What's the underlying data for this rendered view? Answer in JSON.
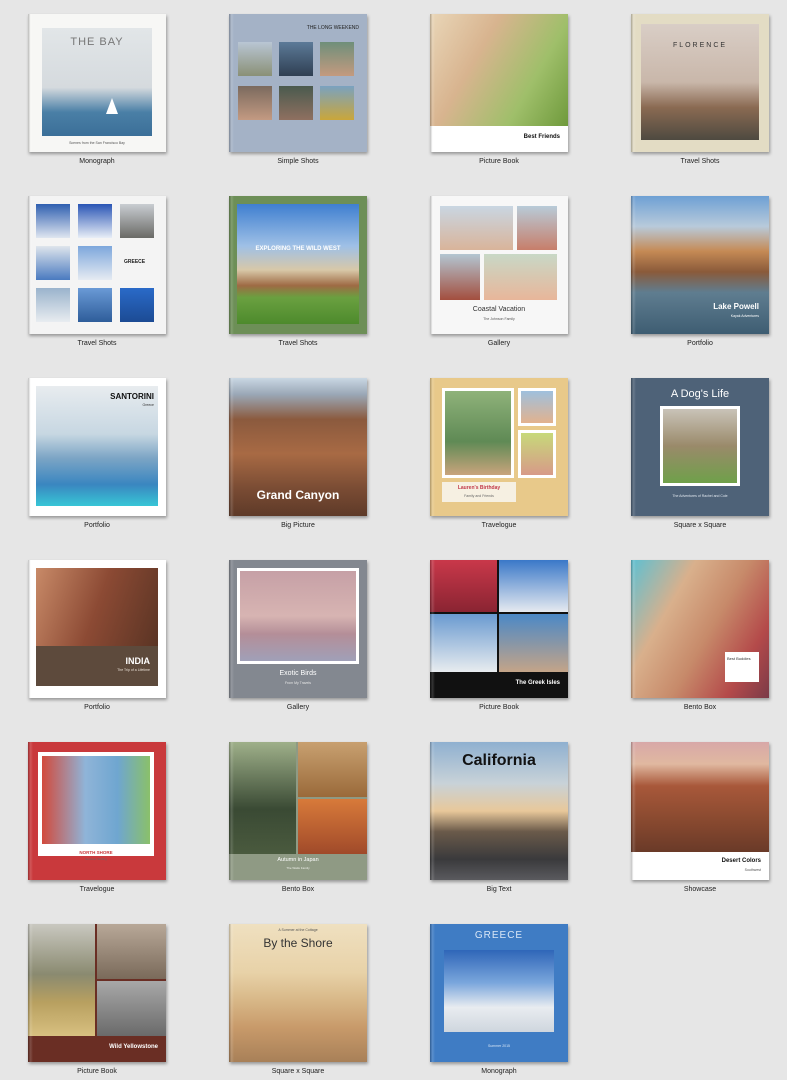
{
  "books": [
    {
      "title": "THE BAY",
      "subtitle": "Scenes from the San Francisco Bay",
      "style": "Monograph"
    },
    {
      "title": "THE LONG WEEKEND",
      "style": "Simple Shots"
    },
    {
      "title": "Best Friends",
      "style": "Picture Book"
    },
    {
      "title": "FLORENCE",
      "style": "Travel Shots"
    },
    {
      "title": "GREECE",
      "style": "Travel Shots"
    },
    {
      "title": "EXPLORING THE WILD WEST",
      "style": "Travel Shots"
    },
    {
      "title": "Coastal Vacation",
      "subtitle": "The Johnson Family",
      "style": "Gallery"
    },
    {
      "title": "Lake Powell",
      "subtitle": "Kayak Adventures",
      "style": "Portfolio"
    },
    {
      "title": "SANTORINI",
      "subtitle": "Greece",
      "style": "Portfolio"
    },
    {
      "title": "Grand Canyon",
      "style": "Big Picture"
    },
    {
      "title": "Lauren's Birthday",
      "subtitle": "Family and Friends",
      "style": "Travelogue"
    },
    {
      "title": "A Dog's Life",
      "subtitle": "The Adventures of Rachel and Cole",
      "style": "Square x Square"
    },
    {
      "title": "INDIA",
      "subtitle": "The Trip of a Lifetime",
      "style": "Portfolio"
    },
    {
      "title": "Exotic Birds",
      "subtitle": "From My Travels",
      "style": "Gallery"
    },
    {
      "title": "The Greek Isles",
      "style": "Picture Book"
    },
    {
      "title": "Best Buddies",
      "style": "Bento Box"
    },
    {
      "title": "NORTH SHORE",
      "subtitle": "Summer Surfing",
      "style": "Travelogue"
    },
    {
      "title": "Autumn in Japan",
      "subtitle": "The Watts Family",
      "style": "Bento Box"
    },
    {
      "title": "California",
      "style": "Big Text"
    },
    {
      "title": "Desert Colors",
      "subtitle": "Southwest",
      "style": "Showcase"
    },
    {
      "title": "Wild Yellowstone",
      "style": "Picture Book"
    },
    {
      "title": "By the Shore",
      "subtitle": "A Summer at the Cottage",
      "style": "Square x Square"
    },
    {
      "title": "GREECE",
      "subtitle": "Summer 2015",
      "style": "Monograph"
    }
  ]
}
